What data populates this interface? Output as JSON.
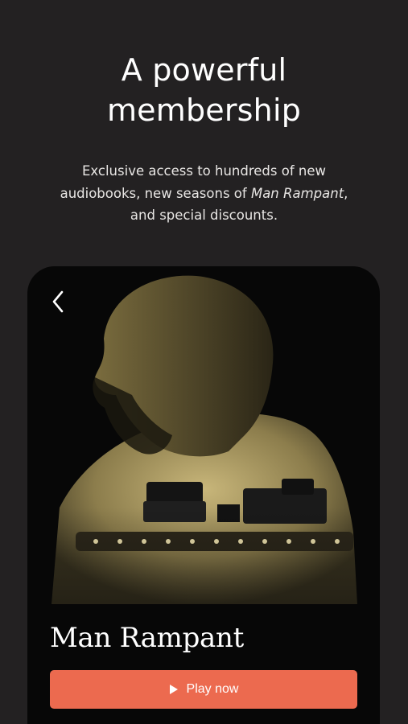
{
  "header": {
    "title_line1": "A powerful",
    "title_line2": "membership"
  },
  "description": {
    "part1": "Exclusive access to hundreds of new audiobooks, new seasons of ",
    "italic": "Man Rampant",
    "part2": ", and special discounts."
  },
  "card": {
    "title": "Man Rampant",
    "play_label": "Play now",
    "back_icon": "chevron-left-icon",
    "play_icon": "play-icon"
  },
  "colors": {
    "background": "#232122",
    "card_background": "#070707",
    "accent": "#ec6a4f",
    "art_tone": "#b8a66a"
  }
}
